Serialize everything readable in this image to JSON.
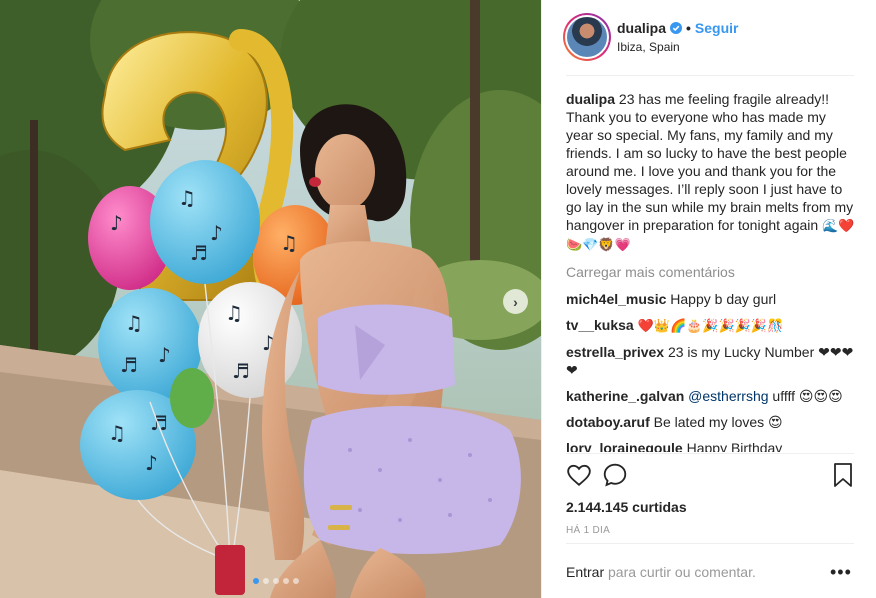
{
  "post": {
    "username": "dualipa",
    "follow_label": "Seguir",
    "separator": "•",
    "location": "Ibiza, Spain",
    "caption_user": "dualipa",
    "caption_text": "23 has me feeling fragile already!! Thank you to everyone who has made my year so special. My fans, my family and my friends. I am so lucky to have the best people around me. I love you and thank you for the lovely messages. I’ll reply soon I just have to go lay in the sun while my brain melts from my hangover in preparation for tonight again",
    "caption_emojis": "🌊❤️🍉💎🦁💗",
    "load_more": "Carregar mais comentários",
    "comments": [
      {
        "user": "mich4el_music",
        "text": "Happy b day gurl"
      },
      {
        "user": "tv__kuksa",
        "text": "❤️👑🌈🎂🎉🎉🎉🎉🎊"
      },
      {
        "user": "estrella_privex",
        "text": "23 is my Lucky Number ❤❤❤❤"
      },
      {
        "user": "katherine_.galvan",
        "mention": "@estherrshg",
        "text": "uffff 😍😍😍"
      },
      {
        "user": "dotaboy.aruf",
        "text": "Be lated my loves 😍"
      },
      {
        "user": "lory_lorainegoule",
        "text": "Happy Birthday"
      }
    ],
    "likes": "2.144.145 curtidas",
    "time": "HÁ 1 DIA",
    "login_label": "Entrar",
    "comment_placeholder": "para curtir ou comentar.",
    "more_label": "•••",
    "carousel_arrow": "›"
  },
  "icons": {
    "like": "heart-outline-icon",
    "comment": "speech-bubble-icon",
    "save": "bookmark-icon",
    "verified": "verified-badge-icon"
  },
  "colors": {
    "link": "#3897f0",
    "text": "#262626",
    "muted": "#8e8e8e",
    "balloon_blue": "#5bc2e7",
    "balloon_pink": "#e84aa0",
    "balloon_orange": "#f37f2a",
    "balloon_white": "#f4f4f4",
    "balloon_gold": "#e2b92f",
    "outfit": "#c7b6e8"
  },
  "carousel": {
    "count": 5,
    "active": 1
  }
}
